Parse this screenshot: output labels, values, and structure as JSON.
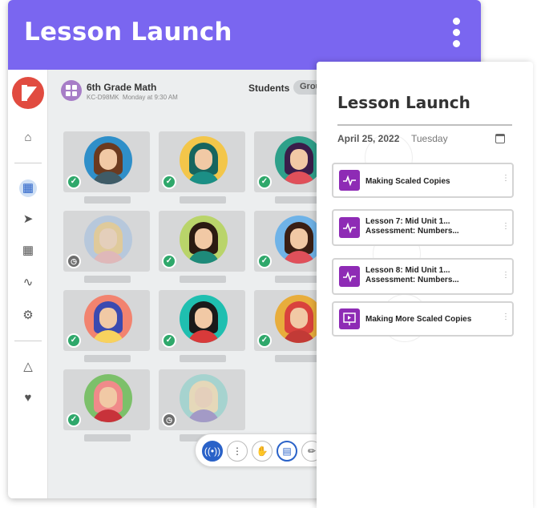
{
  "app": {
    "title": "Lesson Launch"
  },
  "class": {
    "name": "6th Grade Math",
    "code": "KC-D98MK",
    "schedule": "Monday at 9:30 AM"
  },
  "header": {
    "students_label": "Students",
    "group_label": "Group"
  },
  "sidebar": {
    "items": [
      "home-icon",
      "classroom-icon",
      "megaphone-icon",
      "calendar-icon",
      "chart-icon",
      "gear-icon",
      "org-chart-icon",
      "heart-icon"
    ]
  },
  "students": [
    {
      "status": "checked",
      "bg": "#2f8fc9",
      "hair": "#6b3a1f",
      "shirt": "#3f5b66"
    },
    {
      "status": "checked",
      "bg": "#f3c64a",
      "hair": "#17655f",
      "shirt": "#1b8f86"
    },
    {
      "status": "checked",
      "bg": "#2ea08a",
      "hair": "#3a1d4a",
      "shirt": "#e0505a"
    },
    {
      "status": "pending",
      "bg": "#9fbde0",
      "hair": "#e8c06a",
      "shirt": "#e8a0a0"
    },
    {
      "status": "checked",
      "bg": "#b9d46a",
      "hair": "#2b1b12",
      "shirt": "#1e8a7a"
    },
    {
      "status": "checked",
      "bg": "#6fb3e8",
      "hair": "#3a1f14",
      "shirt": "#e0505a"
    },
    {
      "status": "checked",
      "bg": "#f2836f",
      "hair": "#3b4ab0",
      "shirt": "#f7d25e"
    },
    {
      "status": "checked",
      "bg": "#1fbfb0",
      "hair": "#1a1a1a",
      "shirt": "#d83a3a"
    },
    {
      "status": "checked",
      "bg": "#e8ad3c",
      "hair": "#d9423d",
      "shirt": "#c23a36"
    },
    {
      "status": "checked",
      "bg": "#7cc06a",
      "hair": "#f08a8a",
      "shirt": "#c8323a"
    },
    {
      "status": "pending",
      "bg": "#7fd1c8",
      "hair": "#f2d9a0",
      "shirt": "#7a6ab8"
    }
  ],
  "toolbar": {
    "buttons": [
      "broadcast-icon",
      "more-icon",
      "raise-hand-icon",
      "screen-share-icon",
      "ruler-icon",
      "chat-icon"
    ]
  },
  "panel": {
    "title": "Lesson Launch",
    "date": "April 25, 2022",
    "weekday": "Tuesday",
    "lessons": [
      {
        "title": "Making Scaled Copies"
      },
      {
        "title": "Lesson 7: Mid Unit 1... Assessment: Numbers..."
      },
      {
        "title": "Lesson 8: Mid Unit 1... Assessment: Numbers..."
      },
      {
        "title": "Making More Scaled Copies"
      }
    ]
  },
  "colors": {
    "topbar": "#7a66f0",
    "logo": "#e14b40",
    "check": "#2fa86b",
    "lesson_icon": "#8e2bb5",
    "active_tool": "#2a62c8"
  }
}
